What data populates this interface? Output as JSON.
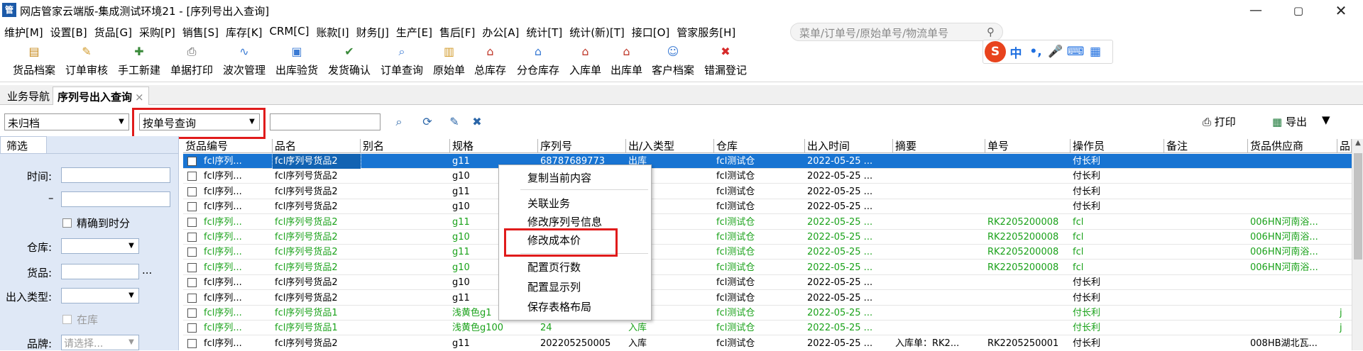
{
  "window": {
    "app_icon": "管",
    "title": "网店管家云端版-集成测试环境21 - [序列号出入查询]",
    "min": "—",
    "max": "▢",
    "close": "✕"
  },
  "menu": {
    "items": [
      "维护[M]",
      "设置[B]",
      "货品[G]",
      "采购[P]",
      "销售[S]",
      "库存[K]",
      "CRM[C]",
      "账款[I]",
      "财务[J]",
      "生产[E]",
      "售后[F]",
      "办公[A]",
      "统计[T]",
      "统计(新)[T]",
      "接口[O]",
      "管家服务[H]"
    ],
    "search_placeholder": "菜单/订单号/原始单号/物流单号"
  },
  "ime": {
    "logo": "S",
    "items": [
      "中",
      "•,",
      "🎤",
      "⌨",
      "▦"
    ]
  },
  "toolbar": {
    "items": [
      {
        "label": "货品档案",
        "icon": "goods-file-icon"
      },
      {
        "label": "订单审核",
        "icon": "order-audit-icon"
      },
      {
        "label": "手工新建",
        "icon": "manual-new-icon"
      },
      {
        "label": "单据打印",
        "icon": "print-doc-icon"
      },
      {
        "label": "波次管理",
        "icon": "wave-icon"
      },
      {
        "label": "出库验货",
        "icon": "outbound-check-icon"
      },
      {
        "label": "发货确认",
        "icon": "ship-confirm-icon"
      },
      {
        "label": "订单查询",
        "icon": "order-query-icon"
      },
      {
        "label": "原始单",
        "icon": "raw-order-icon"
      },
      {
        "label": "总库存",
        "icon": "total-stock-icon"
      },
      {
        "label": "分仓库存",
        "icon": "warehouse-stock-icon"
      },
      {
        "label": "入库单",
        "icon": "inbound-icon"
      },
      {
        "label": "出库单",
        "icon": "outbound-icon"
      },
      {
        "label": "客户档案",
        "icon": "customer-file-icon"
      },
      {
        "label": "错漏登记",
        "icon": "error-register-icon"
      }
    ]
  },
  "tabs": {
    "nav": "业务导航",
    "serial": "序列号出入查询",
    "close": "×"
  },
  "filter": {
    "archive": "未归档",
    "query_type": "按单号查询",
    "query_value": "",
    "print": "打印",
    "export": "导出",
    "export_arrow": "▼"
  },
  "left_panel": {
    "tab": "筛选",
    "time_label": "时间:",
    "dash": "–",
    "precise": "精确到时分",
    "warehouse_label": "仓库:",
    "goods_label": "货品:",
    "goods_more": "...",
    "io_type_label": "出入类型:",
    "in_stock": "在库",
    "brand_label": "品牌:",
    "brand_placeholder": "请选择..."
  },
  "grid": {
    "columns": [
      "货品编号",
      "品名",
      "别名",
      "规格",
      "序列号",
      "出/入类型",
      "仓库",
      "出入时间",
      "摘要",
      "单号",
      "操作员",
      "备注",
      "货品供应商",
      "品"
    ],
    "rows": [
      {
        "style": "selected",
        "cells": [
          "fcl序列...",
          "fcl序列号货品2",
          "",
          "g11",
          "68787689773",
          "出库",
          "fcl测试仓",
          "2022-05-25 ...",
          "",
          "",
          "付长利",
          "",
          "",
          ""
        ]
      },
      {
        "style": "normal",
        "cells": [
          "fcl序列...",
          "fcl序列号货品2",
          "",
          "g10",
          "",
          "",
          "fcl测试仓",
          "2022-05-25 ...",
          "",
          "",
          "付长利",
          "",
          "",
          ""
        ]
      },
      {
        "style": "normal",
        "cells": [
          "fcl序列...",
          "fcl序列号货品2",
          "",
          "g11",
          "",
          "",
          "fcl测试仓",
          "2022-05-25 ...",
          "",
          "",
          "付长利",
          "",
          "",
          ""
        ]
      },
      {
        "style": "normal",
        "cells": [
          "fcl序列...",
          "fcl序列号货品2",
          "",
          "g10",
          "",
          "",
          "fcl测试仓",
          "2022-05-25 ...",
          "",
          "",
          "付长利",
          "",
          "",
          ""
        ]
      },
      {
        "style": "green",
        "cells": [
          "fcl序列...",
          "fcl序列号货品2",
          "",
          "g11",
          "",
          "",
          "fcl测试仓",
          "2022-05-25 ...",
          "",
          "RK2205200008",
          "fcl",
          "",
          "006HN河南浴...",
          ""
        ]
      },
      {
        "style": "green",
        "cells": [
          "fcl序列...",
          "fcl序列号货品2",
          "",
          "g10",
          "",
          "",
          "fcl测试仓",
          "2022-05-25 ...",
          "",
          "RK2205200008",
          "fcl",
          "",
          "006HN河南浴...",
          ""
        ]
      },
      {
        "style": "green",
        "cells": [
          "fcl序列...",
          "fcl序列号货品2",
          "",
          "g11",
          "",
          "",
          "fcl测试仓",
          "2022-05-25 ...",
          "",
          "RK2205200008",
          "fcl",
          "",
          "006HN河南浴...",
          ""
        ]
      },
      {
        "style": "green",
        "cells": [
          "fcl序列...",
          "fcl序列号货品2",
          "",
          "g10",
          "",
          "",
          "fcl测试仓",
          "2022-05-25 ...",
          "",
          "RK2205200008",
          "fcl",
          "",
          "006HN河南浴...",
          ""
        ]
      },
      {
        "style": "normal",
        "cells": [
          "fcl序列...",
          "fcl序列号货品2",
          "",
          "g10",
          "",
          "",
          "fcl测试仓",
          "2022-05-25 ...",
          "",
          "",
          "付长利",
          "",
          "",
          ""
        ]
      },
      {
        "style": "normal",
        "cells": [
          "fcl序列...",
          "fcl序列号货品2",
          "",
          "g11",
          "",
          "",
          "fcl测试仓",
          "2022-05-25 ...",
          "",
          "",
          "付长利",
          "",
          "",
          ""
        ]
      },
      {
        "style": "green",
        "cells": [
          "fcl序列...",
          "fcl序列号货品1",
          "",
          "浅黄色g1",
          "",
          "",
          "fcl测试仓",
          "2022-05-25 ...",
          "",
          "",
          "付长利",
          "",
          "",
          "j"
        ]
      },
      {
        "style": "green",
        "cells": [
          "fcl序列...",
          "fcl序列号货品1",
          "",
          "浅黄色g100",
          "24",
          "入库",
          "fcl测试仓",
          "2022-05-25 ...",
          "",
          "",
          "付长利",
          "",
          "",
          "j"
        ]
      },
      {
        "style": "normal",
        "cells": [
          "fcl序列...",
          "fcl序列号货品2",
          "",
          "g11",
          "202205250005",
          "入库",
          "fcl测试仓",
          "2022-05-25 ...",
          "入库单：RK2...",
          "RK2205250001",
          "付长利",
          "",
          "008HB湖北瓦...",
          ""
        ]
      }
    ]
  },
  "context_menu": {
    "copy": "复制当前内容",
    "related": "关联业务",
    "modify_serial": "修改序列号信息",
    "modify_cost": "修改成本价",
    "page_rows": "配置页行数",
    "display_cols": "配置显示列",
    "save_layout": "保存表格布局"
  },
  "colors": {
    "selected_row": "#1874d2",
    "green_row": "#1aa21a",
    "highlight": "#e01b1b",
    "panel_bg": "#dfe8f6"
  }
}
